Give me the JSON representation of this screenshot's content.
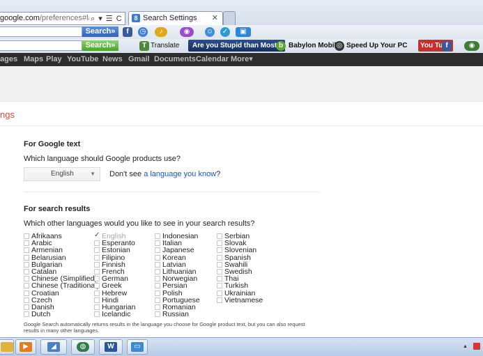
{
  "browser": {
    "address_prefix": "google.com",
    "address_path": "/preferences#language",
    "address_tools": "⌕ ▾ ☰ C ✕",
    "active_tab": "Search Settings",
    "active_tab_close": "✕"
  },
  "toolbar1": {
    "search_label": "Search»",
    "icons": [
      "facebook-icon",
      "alarm-icon",
      "music-icon",
      "games-icon",
      "chat-icon",
      "shield-icon",
      "tv-icon"
    ]
  },
  "toolbar2": {
    "search_label": "Search»",
    "translate_label": "Translate",
    "stupid_label": "Are you Stupid than Most?",
    "babylon_label": "Babylon Mobile",
    "speed_label": "Speed Up Your PC",
    "youtube_label": "You Tube"
  },
  "google_nav": [
    "ages",
    "Maps",
    "Play",
    "YouTube",
    "News",
    "Gmail",
    "Documents",
    "Calendar",
    "More▾"
  ],
  "page": {
    "heading": "ngs",
    "google_text": {
      "title": "For Google text",
      "question": "Which language should Google products use?",
      "selected_language": "English",
      "dont_see_prefix": "Don't see ",
      "dont_see_link": "a language you know",
      "dont_see_suffix": "?"
    },
    "search_results": {
      "title": "For search results",
      "question": "Which other languages would you like to see in your search results?",
      "columns": [
        [
          "Afrikaans",
          "Arabic",
          "Armenian",
          "Belarusian",
          "Bulgarian",
          "Catalan",
          "Chinese (Simplified)",
          "Chinese (Traditional)",
          "Croatian",
          "Czech",
          "Danish",
          "Dutch"
        ],
        [
          "English",
          "Esperanto",
          "Estonian",
          "Filipino",
          "Finnish",
          "French",
          "German",
          "Greek",
          "Hebrew",
          "Hindi",
          "Hungarian",
          "Icelandic"
        ],
        [
          "Indonesian",
          "Italian",
          "Japanese",
          "Korean",
          "Latvian",
          "Lithuanian",
          "Norwegian",
          "Persian",
          "Polish",
          "Portuguese",
          "Romanian",
          "Russian"
        ],
        [
          "Serbian",
          "Slovak",
          "Slovenian",
          "Spanish",
          "Swahili",
          "Swedish",
          "Thai",
          "Turkish",
          "Ukrainian",
          "Vietnamese"
        ]
      ],
      "checked": "English",
      "footnote": "Google Search automatically returns results in the language you choose for Google product text, but you can also request results in many other languages."
    }
  },
  "taskbar": {
    "items": [
      "explorer-icon",
      "media-player-icon",
      "documents-icon",
      "globe-icon",
      "word-icon",
      "screenshot-icon"
    ],
    "word_letter": "W"
  },
  "colors": {
    "heading_red": "#dd4b39",
    "link_blue": "#1155cc",
    "gbar": "#2d2d2d"
  }
}
